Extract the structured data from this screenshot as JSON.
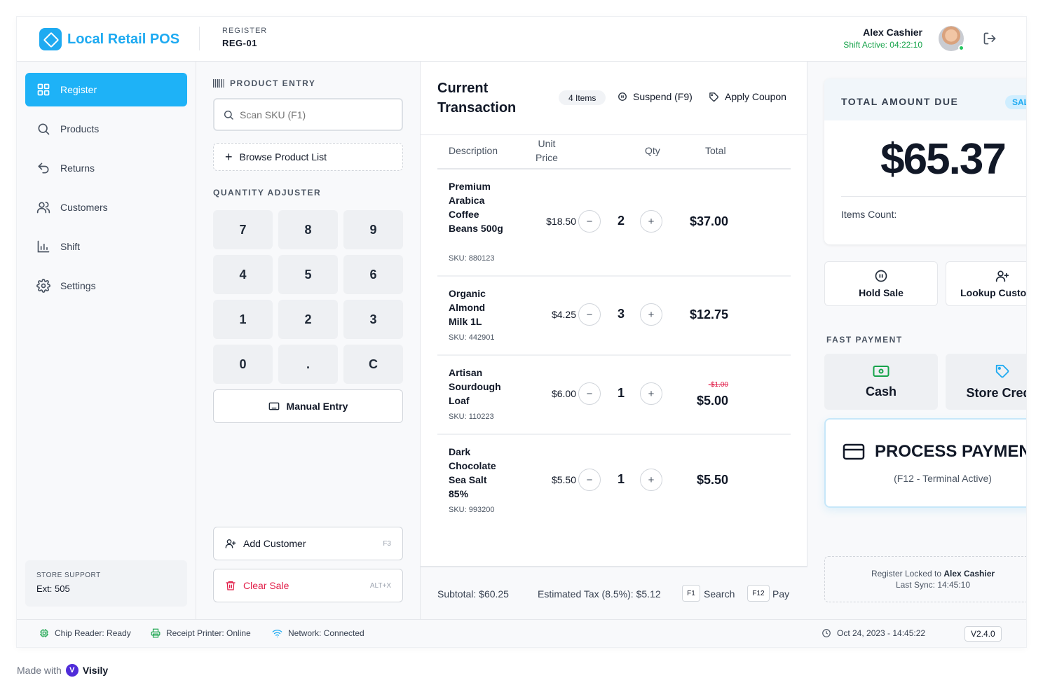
{
  "app": {
    "title": "Local Retail POS",
    "register_label": "REGISTER",
    "register_value": "REG-01"
  },
  "user": {
    "name": "Alex Cashier",
    "shift": "Shift Active: 04:22:10"
  },
  "sidebar": {
    "items": [
      {
        "label": "Register",
        "icon": "grid-icon",
        "active": true
      },
      {
        "label": "Products",
        "icon": "search-icon"
      },
      {
        "label": "Returns",
        "icon": "return-arrow-icon"
      },
      {
        "label": "Customers",
        "icon": "users-icon"
      },
      {
        "label": "Shift",
        "icon": "bar-chart-icon"
      },
      {
        "label": "Settings",
        "icon": "gear-icon"
      }
    ],
    "support_label": "STORE SUPPORT",
    "support_value": "Ext: 505"
  },
  "entry": {
    "title": "PRODUCT ENTRY",
    "scan_placeholder": "Scan SKU (F1)",
    "browse_label": "Browse Product List",
    "qty_title": "QUANTITY ADJUSTER",
    "keys": [
      "7",
      "8",
      "9",
      "4",
      "5",
      "6",
      "1",
      "2",
      "3",
      "0",
      ".",
      "C"
    ],
    "manual_label": "Manual Entry",
    "add_customer_label": "Add Customer",
    "add_customer_kbd": "F3",
    "clear_sale_label": "Clear Sale",
    "clear_sale_kbd": "ALT+X"
  },
  "transaction": {
    "title": "Current Transaction",
    "items_pill": "4 Items",
    "suspend_label": "Suspend (F9)",
    "coupon_label": "Apply Coupon",
    "columns": {
      "description": "Description",
      "unit_price": "Unit Price",
      "qty": "Qty",
      "total": "Total"
    },
    "rows": [
      {
        "name": "Premium Arabica Coffee Beans 500g",
        "sku": "SKU: 880123",
        "price": "$18.50",
        "qty": "2",
        "total": "$37.00"
      },
      {
        "name": "Organic Almond Milk 1L",
        "sku": "SKU: 442901",
        "price": "$4.25",
        "qty": "3",
        "total": "$12.75"
      },
      {
        "name": "Artisan Sourdough Loaf",
        "sku": "SKU: 110223",
        "price": "$6.00",
        "qty": "1",
        "total": "$5.00",
        "discount": "-$1.00"
      },
      {
        "name": "Dark Chocolate Sea Salt 85%",
        "sku": "SKU: 993200",
        "price": "$5.50",
        "qty": "1",
        "total": "$5.50"
      }
    ],
    "subtotal": "Subtotal: $60.25",
    "tax": "Estimated Tax (8.5%): $5.12",
    "search_kbd": "F1",
    "search_label": "Search",
    "pay_kbd": "F12",
    "pay_label": "Pay"
  },
  "payment": {
    "total_label": "TOTAL AMOUNT DUE",
    "sale_tag": "SALE",
    "total": "$65.37",
    "items_count_label": "Items Count:",
    "hold_label": "Hold Sale",
    "lookup_label": "Lookup Customer",
    "fast_label": "FAST PAYMENT",
    "cash_label": "Cash",
    "store_credit_label": "Store Credit",
    "process_label": "PROCESS PAYMENT",
    "process_sub": "(F12 - Terminal Active)",
    "lock_text": "Register Locked to",
    "lock_name": "Alex Cashier",
    "last_sync": "Last Sync: 14:45:10"
  },
  "status": {
    "chip_reader": "Chip Reader: Ready",
    "printer": "Receipt Printer: Online",
    "network": "Network: Connected",
    "datetime": "Oct 24, 2023 - 14:45:22",
    "version": "V2.4.0"
  },
  "footer": {
    "made_with": "Made with",
    "brand": "Visily"
  },
  "colors": {
    "accent": "#1eaaf1",
    "success": "#16a34a",
    "danger": "#e11d48"
  }
}
